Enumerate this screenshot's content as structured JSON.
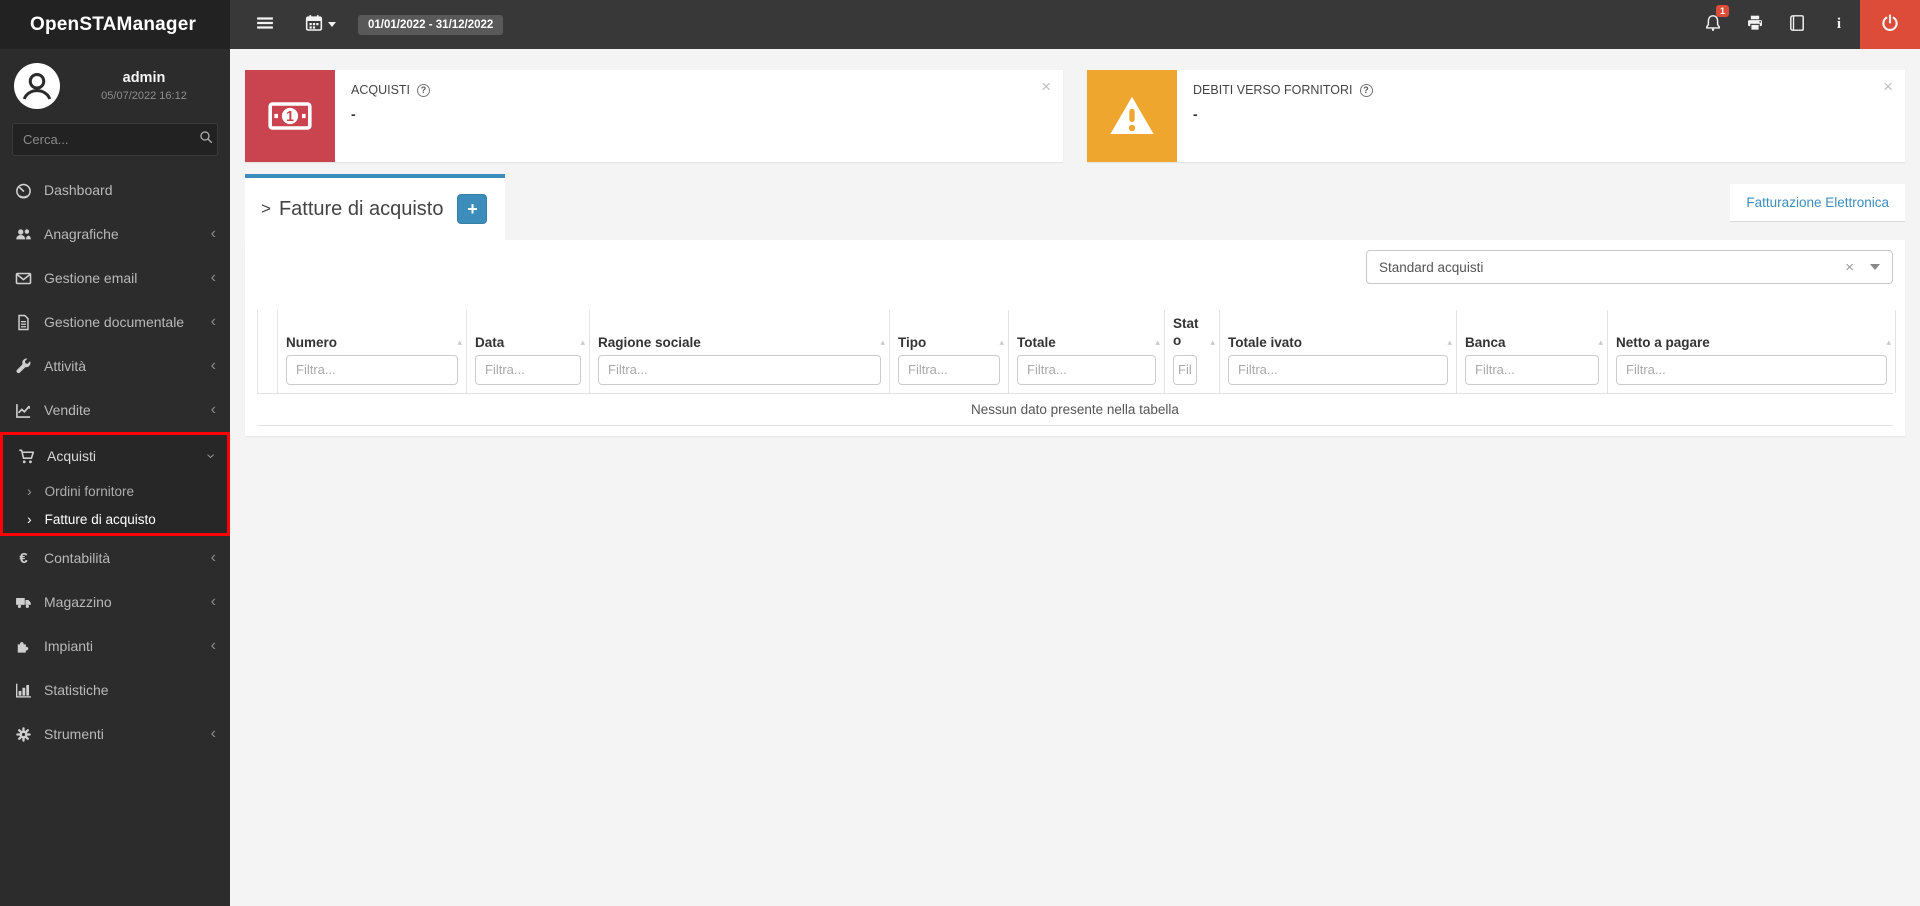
{
  "app": {
    "title": "OpenSTAManager"
  },
  "topbar": {
    "date_range": "01/01/2022 - 31/12/2022",
    "notification_count": "1"
  },
  "sidebar": {
    "user": {
      "name": "admin",
      "datetime": "05/07/2022 16:12"
    },
    "search_placeholder": "Cerca...",
    "items": [
      {
        "label": "Dashboard"
      },
      {
        "label": "Anagrafiche"
      },
      {
        "label": "Gestione email"
      },
      {
        "label": "Gestione documentale"
      },
      {
        "label": "Attività"
      },
      {
        "label": "Vendite"
      },
      {
        "label": "Acquisti"
      },
      {
        "label": "Contabilità"
      },
      {
        "label": "Magazzino"
      },
      {
        "label": "Impianti"
      },
      {
        "label": "Statistiche"
      },
      {
        "label": "Strumenti"
      }
    ],
    "acquisti_children": [
      {
        "label": "Ordini fornitore"
      },
      {
        "label": "Fatture di acquisto"
      }
    ]
  },
  "widgets": [
    {
      "title": "ACQUISTI",
      "value": "-"
    },
    {
      "title": "DEBITI VERSO FORNITORI",
      "value": "-"
    }
  ],
  "tabs": {
    "title_prefix": ">",
    "active_label": "Fatture di acquisto",
    "add_label": "+",
    "right_tab_label": "Fatturazione Elettronica"
  },
  "filters": {
    "preset_value": "Standard acquisti"
  },
  "table": {
    "columns": [
      {
        "label": "Numero",
        "filter": "Filtra..."
      },
      {
        "label": "Data",
        "filter": "Filtra..."
      },
      {
        "label": "Ragione sociale",
        "filter": "Filtra..."
      },
      {
        "label": "Tipo",
        "filter": "Filtra..."
      },
      {
        "label": "Totale",
        "filter": "Filtra..."
      },
      {
        "label": "Stato",
        "filter": "Filtra..."
      },
      {
        "label": "Totale ivato",
        "filter": "Filtra..."
      },
      {
        "label": "Banca",
        "filter": "Filtra..."
      },
      {
        "label": "Netto a pagare",
        "filter": "Filtra..."
      }
    ],
    "empty_text": "Nessun dato presente nella tabella"
  },
  "icons": {
    "close": "×",
    "clear": "×",
    "chevron_right": "›",
    "chevron_left": "‹",
    "sort": "▴",
    "help": "?",
    "euro": "€",
    "info": "i"
  },
  "colors": {
    "accent_blue": "#3c8dbc",
    "danger_red": "#dd4b39",
    "widget_red": "#ca4450",
    "widget_yellow": "#efa62f",
    "highlight_red": "#ff0000"
  }
}
